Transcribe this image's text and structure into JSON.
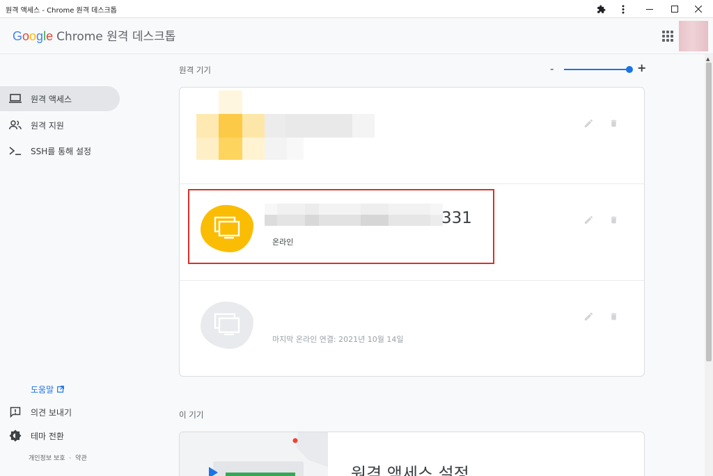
{
  "window": {
    "title": "원격 액세스 - Chrome 원격 데스크톱"
  },
  "header": {
    "logo_google": [
      "G",
      "o",
      "o",
      "g",
      "l",
      "e"
    ],
    "logo_product": "Chrome 원격 데스크톱"
  },
  "sidebar": {
    "items": [
      {
        "label": "원격 액세스",
        "icon": "laptop-icon",
        "active": true
      },
      {
        "label": "원격 지원",
        "icon": "people-icon",
        "active": false
      },
      {
        "label": "SSH를 통해 설정",
        "icon": "terminal-icon",
        "active": false
      }
    ],
    "help_label": "도움말",
    "feedback_label": "의견 보내기",
    "theme_label": "테마 전환",
    "privacy_label": "개인정보 보호",
    "legal_separator": "·",
    "terms_label": "약관"
  },
  "main": {
    "remote_devices_title": "원격 기기",
    "zoom": {
      "minus": "-",
      "plus": "+"
    },
    "devices": [
      {
        "name": "",
        "status": "",
        "state": "unknown"
      },
      {
        "name": "331",
        "status": "온라인",
        "state": "online"
      },
      {
        "name": "",
        "status": "마지막 온라인 연결: 2021년 10월 14일",
        "state": "offline"
      }
    ],
    "this_device_title": "이 기기",
    "this_device_heading": "원격 액세스 설정"
  },
  "colors": {
    "accent": "#1a73e8",
    "online": "#fbbc04",
    "highlight": "#d93025"
  }
}
